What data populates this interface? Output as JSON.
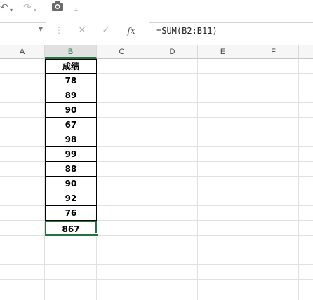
{
  "formula_bar": {
    "name_box": "",
    "cancel_icon": "✕",
    "enter_icon": "✓",
    "fx_label": "fx",
    "formula": "=SUM(B2:B11)"
  },
  "columns": [
    "A",
    "B",
    "C",
    "D",
    "E",
    "F"
  ],
  "selected_column": "B",
  "sheet": {
    "header": "成绩",
    "values": [
      "78",
      "89",
      "90",
      "67",
      "98",
      "99",
      "88",
      "90",
      "92",
      "76"
    ],
    "total": "867"
  },
  "colors": {
    "accent": "#217346",
    "gridline": "#e1e1e1",
    "border": "#000000"
  },
  "icons": [
    "undo-icon",
    "redo-icon",
    "camera-icon",
    "customize-qat-icon",
    "chevron-down-icon"
  ]
}
